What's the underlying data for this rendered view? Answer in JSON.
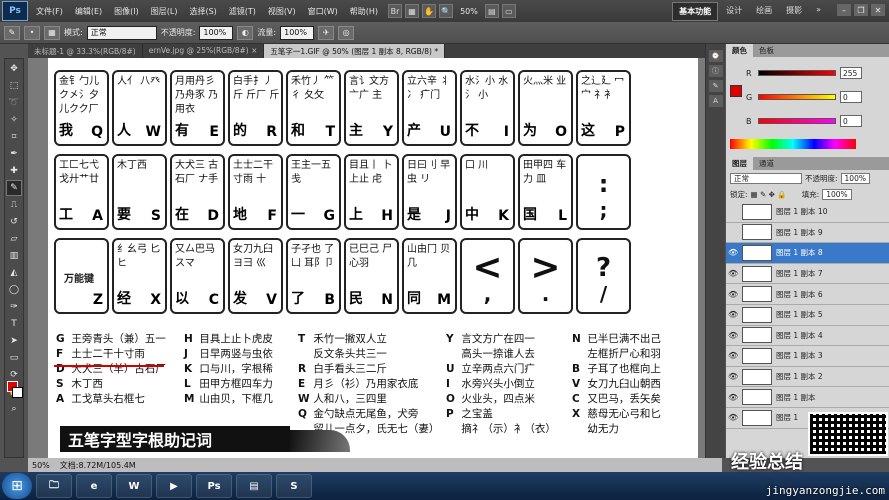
{
  "menubar": {
    "logo": "Ps",
    "items": [
      "文件(F)",
      "编辑(E)",
      "图像(I)",
      "图层(L)",
      "选择(S)",
      "滤镜(T)",
      "视图(V)",
      "窗口(W)",
      "帮助(H)"
    ],
    "zoom": "50%",
    "workspaces": [
      "基本功能",
      "设计",
      "绘画",
      "摄影"
    ],
    "active_workspace": "基本功能"
  },
  "options": {
    "mode_label": "模式:",
    "mode_value": "正常",
    "opacity_label": "不透明度:",
    "opacity_value": "100%",
    "flow_label": "流量:",
    "flow_value": "100%"
  },
  "tabs": [
    {
      "label": "未标题-1 @ 33.3%(RGB/8#)",
      "active": false
    },
    {
      "label": "ernVe.jpg @ 25%(RGB/8#) ×",
      "active": false
    },
    {
      "label": "五笔字一1.GIF @ 50% (图层 1 副本 8, RGB/8) *",
      "active": true
    }
  ],
  "keyboard": {
    "row1": [
      {
        "glyphs": "金钅勹儿 ク㐅氵夕 儿クク厂",
        "word": "我",
        "letter": "Q"
      },
      {
        "glyphs": "人亻 八癶",
        "word": "人",
        "letter": "W"
      },
      {
        "glyphs": "月用丹彡 乃舟豕 乃用衣",
        "word": "有",
        "letter": "E"
      },
      {
        "glyphs": "白手扌丿 斤 斤厂 斤",
        "word": "的",
        "letter": "R"
      },
      {
        "glyphs": "禾竹丿 ⺮彳 夂攵",
        "word": "和",
        "letter": "T"
      },
      {
        "glyphs": "言讠文方 亠广 主",
        "word": "主",
        "letter": "Y"
      },
      {
        "glyphs": "立六辛 丬冫 疒门",
        "word": "产",
        "letter": "U"
      },
      {
        "glyphs": "水氵小 水氵 小",
        "word": "不",
        "letter": "I"
      },
      {
        "glyphs": "火灬米 业",
        "word": "为",
        "letter": "O"
      },
      {
        "glyphs": "之辶廴 冖宀 礻衤",
        "word": "这",
        "letter": "P"
      }
    ],
    "row2": [
      {
        "glyphs": "工匚七弋 戈廾艹廿",
        "word": "工",
        "letter": "A"
      },
      {
        "glyphs": "木丁西",
        "word": "要",
        "letter": "S"
      },
      {
        "glyphs": "大犬三 古石厂 ナ手",
        "word": "在",
        "letter": "D"
      },
      {
        "glyphs": "土士二干 寸雨 十",
        "word": "地",
        "letter": "F"
      },
      {
        "glyphs": "王主一五 戋",
        "word": "一",
        "letter": "G"
      },
      {
        "glyphs": "目且丨 卜上止 虍",
        "word": "上",
        "letter": "H"
      },
      {
        "glyphs": "日曰刂 早虫 リ",
        "word": "是",
        "letter": "J"
      },
      {
        "glyphs": "口 川",
        "word": "中",
        "letter": "K"
      },
      {
        "glyphs": "田甲四 车力 皿",
        "word": "国",
        "letter": "L"
      }
    ],
    "semicolon": {
      "top": ":",
      "bottom": ";"
    },
    "row3": [
      {
        "label": "万能键",
        "letter": "Z"
      },
      {
        "glyphs": "纟幺弓 匕 ヒ",
        "word": "经",
        "letter": "X"
      },
      {
        "glyphs": "又厶巴马 スマ",
        "word": "以",
        "letter": "C"
      },
      {
        "glyphs": "女刀九臼 ヨ彐 巛",
        "word": "发",
        "letter": "V"
      },
      {
        "glyphs": "子孑也 了凵 耳阝卩",
        "word": "了",
        "letter": "B"
      },
      {
        "glyphs": "已巳己 尸 心羽",
        "word": "民",
        "letter": "N"
      },
      {
        "glyphs": "山由冂 贝 几",
        "word": "同",
        "letter": "M"
      }
    ],
    "comma": {
      "top": "<",
      "bottom": ","
    },
    "period": {
      "top": ">",
      "bottom": "."
    },
    "slash": {
      "top": "?",
      "bottom": "/"
    }
  },
  "mnemonics": {
    "col1": [
      {
        "key": "G",
        "text": "王旁青头（兼）五一"
      },
      {
        "key": "F",
        "text": "土士二干十寸雨"
      },
      {
        "key": "D",
        "text": "大犬三（羊）古石厂"
      },
      {
        "key": "S",
        "text": "木丁西"
      },
      {
        "key": "A",
        "text": "工戈草头右框七"
      }
    ],
    "col2": [
      {
        "key": "H",
        "text": "目具上止卜虎皮"
      },
      {
        "key": "J",
        "text": "日早两竖与虫依"
      },
      {
        "key": "K",
        "text": "口与川，字根稀"
      },
      {
        "key": "L",
        "text": "田甲方框四车力"
      },
      {
        "key": "M",
        "text": "山由贝，下框几"
      }
    ],
    "col3": [
      {
        "key": "T",
        "text": "禾竹一撇双人立"
      },
      {
        "key": "",
        "text": "反文条头共三一"
      },
      {
        "key": "R",
        "text": "白手看头三二斤"
      },
      {
        "key": "E",
        "text": "月彡（衫）乃用家衣底"
      },
      {
        "key": "W",
        "text": "人和八，三四里"
      },
      {
        "key": "Q",
        "text": "金勺缺点无尾鱼，犬旁"
      },
      {
        "key": "",
        "text": "留儿一点夕，氏无七（妻）"
      }
    ],
    "col4": [
      {
        "key": "Y",
        "text": "言文方广在四一"
      },
      {
        "key": "",
        "text": "高头一捺谁人去"
      },
      {
        "key": "U",
        "text": "立辛两点六门疒"
      },
      {
        "key": "I",
        "text": "水旁兴头小倒立"
      },
      {
        "key": "O",
        "text": "火业头，四点米"
      },
      {
        "key": "P",
        "text": "之宝盖"
      },
      {
        "key": "",
        "text": "摘礻（示）衤（衣）"
      }
    ],
    "col5": [
      {
        "key": "N",
        "text": "已半巳满不出己"
      },
      {
        "key": "",
        "text": "左框折尸心和羽"
      },
      {
        "key": "B",
        "text": "子耳了也框向上"
      },
      {
        "key": "V",
        "text": "女刀九臼山朝西"
      },
      {
        "key": "C",
        "text": "又巴马，丢矢矣"
      },
      {
        "key": "X",
        "text": "慈母无心弓和匕"
      },
      {
        "key": "",
        "text": "幼无力"
      }
    ]
  },
  "banner": "五笔字型字根助记词",
  "color_panel": {
    "tabs": [
      "颜色",
      "色板"
    ],
    "r_label": "R",
    "r_value": "255",
    "g_label": "G",
    "g_value": "0",
    "b_label": "B",
    "b_value": "0"
  },
  "layers_panel": {
    "tabs": [
      "图层",
      "通道"
    ],
    "blend": "正常",
    "opacity_label": "不透明度:",
    "opacity_value": "100%",
    "lock_label": "锁定:",
    "fill_label": "填充:",
    "fill_value": "100%",
    "layers": [
      {
        "name": "图层 1 副本 10",
        "visible": false,
        "selected": false
      },
      {
        "name": "图层 1 副本 9",
        "visible": false,
        "selected": false
      },
      {
        "name": "图层 1 副本 8",
        "visible": true,
        "selected": true
      },
      {
        "name": "图层 1 副本 7",
        "visible": true,
        "selected": false
      },
      {
        "name": "图层 1 副本 6",
        "visible": true,
        "selected": false
      },
      {
        "name": "图层 1 副本 5",
        "visible": true,
        "selected": false
      },
      {
        "name": "图层 1 副本 4",
        "visible": true,
        "selected": false
      },
      {
        "name": "图层 1 副本 3",
        "visible": true,
        "selected": false
      },
      {
        "name": "图层 1 副本 2",
        "visible": true,
        "selected": false
      },
      {
        "name": "图层 1 副本",
        "visible": true,
        "selected": false
      },
      {
        "name": "图层 1",
        "visible": true,
        "selected": false
      }
    ]
  },
  "status": {
    "zoom": "50%",
    "doc_info": "文档:8.72M/105.4M"
  },
  "watermark": {
    "text": "经验总结",
    "url": "jingyanzongjie.com"
  },
  "colors": {
    "foreground": "#e00000",
    "background": "#ffffff",
    "selection": "#3a78c8"
  }
}
